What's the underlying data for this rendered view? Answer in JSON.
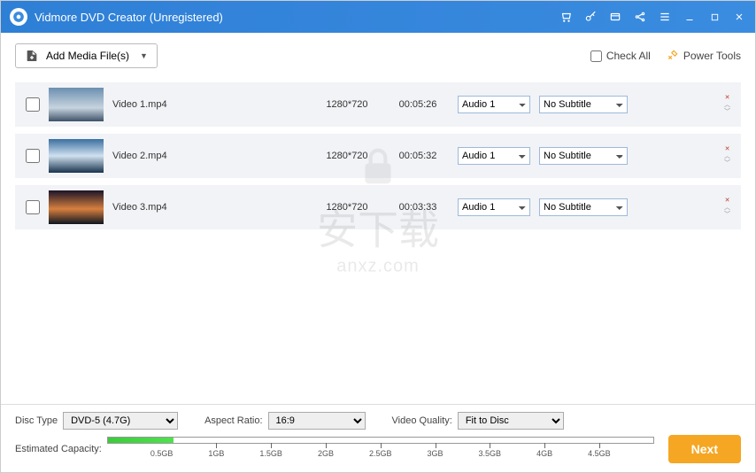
{
  "titlebar": {
    "title": "Vidmore DVD Creator (Unregistered)"
  },
  "toolbar": {
    "add_label": "Add Media File(s)",
    "check_all_label": "Check All",
    "power_tools_label": "Power Tools"
  },
  "files": [
    {
      "name": "Video 1.mp4",
      "resolution": "1280*720",
      "duration": "00:05:26",
      "audio": "Audio 1",
      "subtitle": "No Subtitle"
    },
    {
      "name": "Video 2.mp4",
      "resolution": "1280*720",
      "duration": "00:05:32",
      "audio": "Audio 1",
      "subtitle": "No Subtitle"
    },
    {
      "name": "Video 3.mp4",
      "resolution": "1280*720",
      "duration": "00:03:33",
      "audio": "Audio 1",
      "subtitle": "No Subtitle"
    }
  ],
  "bottom": {
    "disc_type_label": "Disc Type",
    "disc_type_value": "DVD-5 (4.7G)",
    "aspect_label": "Aspect Ratio:",
    "aspect_value": "16:9",
    "quality_label": "Video Quality:",
    "quality_value": "Fit to Disc",
    "capacity_label": "Estimated Capacity:",
    "ticks": [
      "0.5GB",
      "1GB",
      "1.5GB",
      "2GB",
      "2.5GB",
      "3GB",
      "3.5GB",
      "4GB",
      "4.5GB"
    ],
    "next_label": "Next"
  },
  "watermark": {
    "line1": "安下载",
    "line2": "anxz.com"
  }
}
